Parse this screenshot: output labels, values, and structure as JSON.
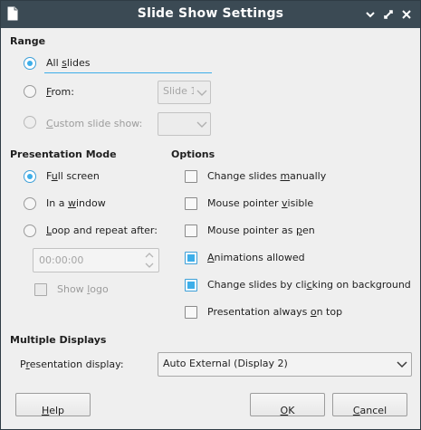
{
  "window": {
    "title": "Slide Show Settings"
  },
  "range": {
    "heading": "Range",
    "all_slides": {
      "pre": "All ",
      "accel": "s",
      "post": "lides",
      "selected": true
    },
    "from": {
      "pre": "",
      "accel": "F",
      "post": "rom:",
      "value": "Slide 1"
    },
    "custom": {
      "pre": "",
      "accel": "C",
      "post": "ustom slide show:",
      "value": ""
    }
  },
  "presentation_mode": {
    "heading": "Presentation Mode",
    "full_screen": {
      "pre": "F",
      "accel": "u",
      "post": "ll screen",
      "selected": true
    },
    "in_window": {
      "pre": "In a ",
      "accel": "w",
      "post": "indow"
    },
    "loop": {
      "pre": "",
      "accel": "L",
      "post": "oop and repeat after:"
    },
    "loop_time": "00:00:00",
    "show_logo": {
      "pre": "Show ",
      "accel": "l",
      "post": "ogo",
      "checked": false
    }
  },
  "options": {
    "heading": "Options",
    "items": [
      {
        "pre": "Change slides ",
        "accel": "m",
        "post": "anually",
        "checked": false
      },
      {
        "pre": "Mouse pointer ",
        "accel": "v",
        "post": "isible",
        "checked": false
      },
      {
        "pre": "Mouse pointer as ",
        "accel": "p",
        "post": "en",
        "checked": false
      },
      {
        "pre": "",
        "accel": "A",
        "post": "nimations allowed",
        "checked": true
      },
      {
        "pre": "Change slides by cli",
        "accel": "c",
        "post": "king on background",
        "checked": true
      },
      {
        "pre": "Presentation always ",
        "accel": "o",
        "post": "n top",
        "checked": false
      }
    ]
  },
  "multiple_displays": {
    "heading": "Multiple Displays",
    "label": {
      "pre": "P",
      "accel": "r",
      "post": "esentation display:"
    },
    "value": "Auto External (Display 2)"
  },
  "buttons": {
    "help": {
      "pre": "",
      "accel": "H",
      "post": "elp"
    },
    "ok": {
      "pre": "",
      "accel": "O",
      "post": "K"
    },
    "cancel": {
      "pre": "",
      "accel": "C",
      "post": "ancel"
    }
  },
  "colors": {
    "titlebar": "#3b4a54",
    "accent": "#3daee9"
  }
}
